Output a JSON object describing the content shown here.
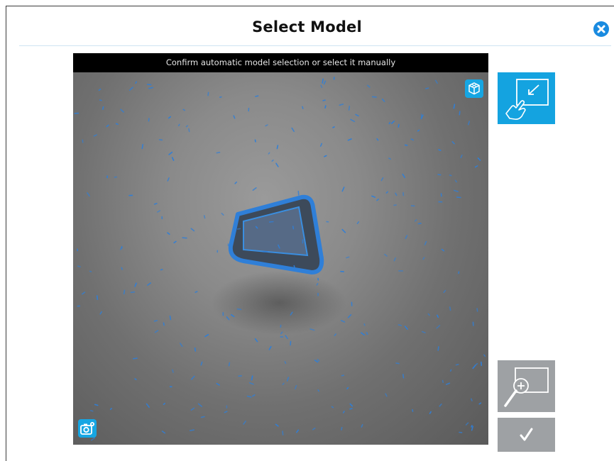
{
  "dialog": {
    "title": "Select Model"
  },
  "viewer": {
    "caption": "Confirm automatic model selection or select it manually"
  },
  "icons": {
    "close": "close-icon",
    "model_3d": "cube-icon",
    "camera_settings": "camera-settings-icon",
    "manual_select": "touch-select-region-icon",
    "zoom": "zoom-in-region-icon",
    "confirm": "checkmark-icon"
  },
  "colors": {
    "accent": "#14a3e0",
    "close": "#1a8be0",
    "disabled": "#9ea1a4",
    "caption_bar": "#000000",
    "edge_overlay": "#2f7fd8"
  }
}
